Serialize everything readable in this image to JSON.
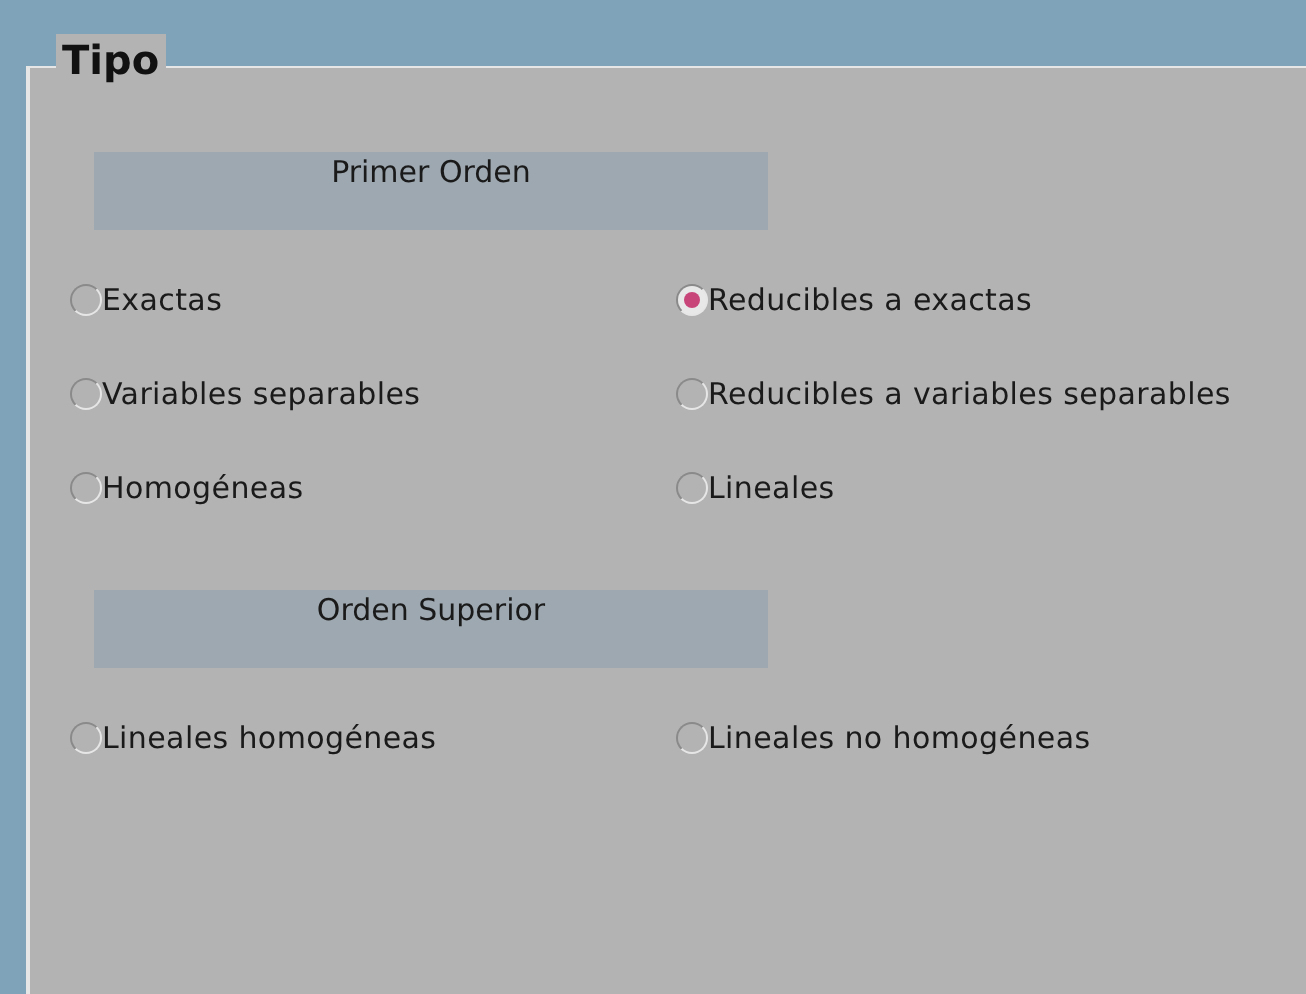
{
  "group": {
    "legend": "Tipo"
  },
  "sections": [
    {
      "title": "Primer Orden",
      "options": [
        {
          "label": "Exactas",
          "selected": false
        },
        {
          "label": "Reducibles a exactas",
          "selected": true
        },
        {
          "label": "Variables separables",
          "selected": false
        },
        {
          "label": "Reducibles a variables separables",
          "selected": false
        },
        {
          "label": "Homogéneas",
          "selected": false
        },
        {
          "label": "Lineales",
          "selected": false
        }
      ]
    },
    {
      "title": "Orden Superior",
      "options": [
        {
          "label": "Lineales homogéneas",
          "selected": false
        },
        {
          "label": "Lineales no homogéneas",
          "selected": false
        }
      ]
    }
  ]
}
